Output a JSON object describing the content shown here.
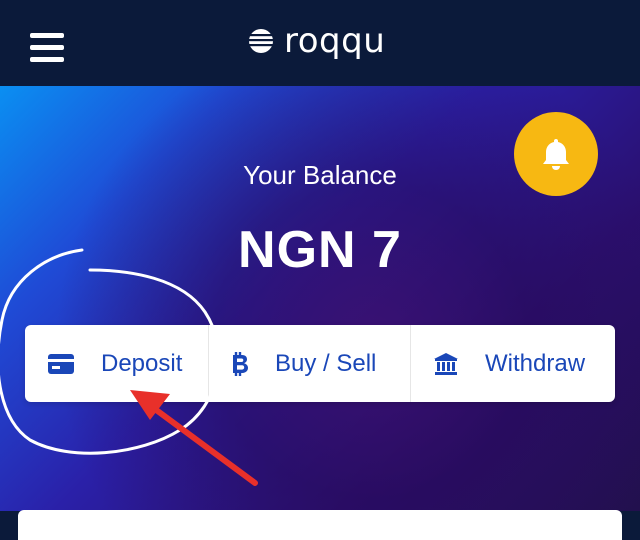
{
  "header": {
    "menu_icon": "hamburger-menu-icon",
    "logo_text": "roqqu",
    "logo_icon": "roqqu-globe-logo"
  },
  "notifications": {
    "icon": "bell-icon",
    "color": "#f7b812"
  },
  "balance": {
    "label": "Your Balance",
    "value": "NGN 7"
  },
  "actions": {
    "deposit": {
      "label": "Deposit",
      "icon": "card-icon"
    },
    "buy_sell": {
      "label": "Buy / Sell",
      "icon": "bitcoin-icon"
    },
    "withdraw": {
      "label": "Withdraw",
      "icon": "bank-icon"
    }
  },
  "colors": {
    "header_bg": "#0b1a3a",
    "action_text": "#1a47b8",
    "annotation_red": "#e8302a"
  }
}
